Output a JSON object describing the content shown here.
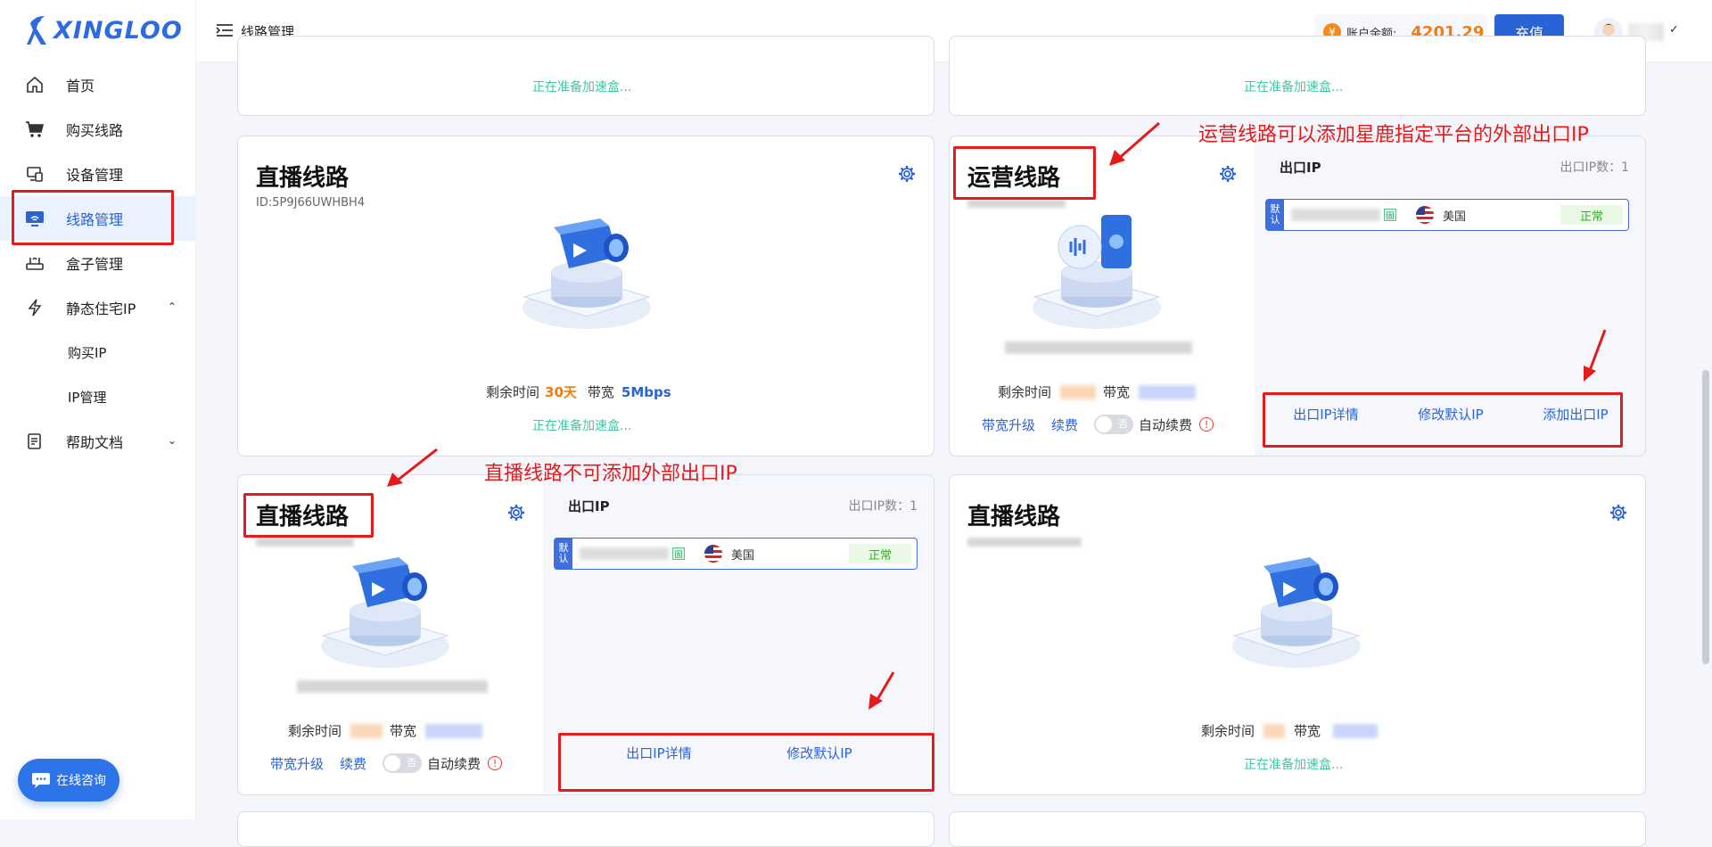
{
  "brand": {
    "name": "XINGLOO"
  },
  "sidebar": {
    "items": [
      {
        "label": "首页",
        "icon": "home-icon"
      },
      {
        "label": "购买线路",
        "icon": "cart-icon"
      },
      {
        "label": "设备管理",
        "icon": "device-icon"
      },
      {
        "label": "线路管理",
        "icon": "monitor-wifi-icon",
        "active": true
      },
      {
        "label": "盒子管理",
        "icon": "router-icon"
      },
      {
        "label": "静态住宅IP",
        "icon": "lightning-icon",
        "expanded": true
      },
      {
        "label": "购买IP",
        "sub": true
      },
      {
        "label": "IP管理",
        "sub": true
      },
      {
        "label": "帮助文档",
        "icon": "document-icon"
      }
    ],
    "chat_label": "在线咨询"
  },
  "header": {
    "breadcrumb": "线路管理",
    "balance_label": "账户余额:",
    "balance_value": "4201.29",
    "recharge_label": "充值"
  },
  "cards": {
    "top_left": {
      "preparing": "正在准备加速盒..."
    },
    "top_right": {
      "preparing": "正在准备加速盒..."
    },
    "live1": {
      "title": "直播线路",
      "id": "ID:5P9J66UWHBH4",
      "remaining_label": "剩余时间",
      "remaining_value": "30天",
      "bandwidth_label": "带宽",
      "bandwidth_value": "5Mbps",
      "preparing": "正在准备加速盒..."
    },
    "ops": {
      "title": "运营线路",
      "remaining_label": "剩余时间",
      "bandwidth_label": "带宽",
      "upgrade": "带宽升级",
      "renew": "续费",
      "toggle_text": "否",
      "auto_renew": "自动续费",
      "exit_title": "出口IP",
      "exit_count": "出口IP数：1",
      "ip_default": "默认",
      "ip_tag": "固",
      "ip_country": "美国",
      "ip_status": "正常",
      "action_detail": "出口IP详情",
      "action_modify": "修改默认IP",
      "action_add": "添加出口IP"
    },
    "live2": {
      "title": "直播线路",
      "remaining_label": "剩余时间",
      "bandwidth_label": "带宽",
      "upgrade": "带宽升级",
      "renew": "续费",
      "toggle_text": "否",
      "auto_renew": "自动续费",
      "exit_title": "出口IP",
      "exit_count": "出口IP数：1",
      "ip_default": "默认",
      "ip_tag": "固",
      "ip_country": "美国",
      "ip_status": "正常",
      "action_detail": "出口IP详情",
      "action_modify": "修改默认IP"
    },
    "live3": {
      "title": "直播线路",
      "remaining_label": "剩余时间",
      "bandwidth_label": "带宽",
      "preparing": "正在准备加速盒..."
    }
  },
  "annotations": {
    "ops_note": "运营线路可以添加星鹿指定平台的外部出口IP",
    "live_note": "直播线路不可添加外部出口IP"
  },
  "colors": {
    "accent": "#2a63d6",
    "orange": "#f47b10",
    "annotation": "#e31b1b",
    "preparing": "#3cc9a7"
  }
}
